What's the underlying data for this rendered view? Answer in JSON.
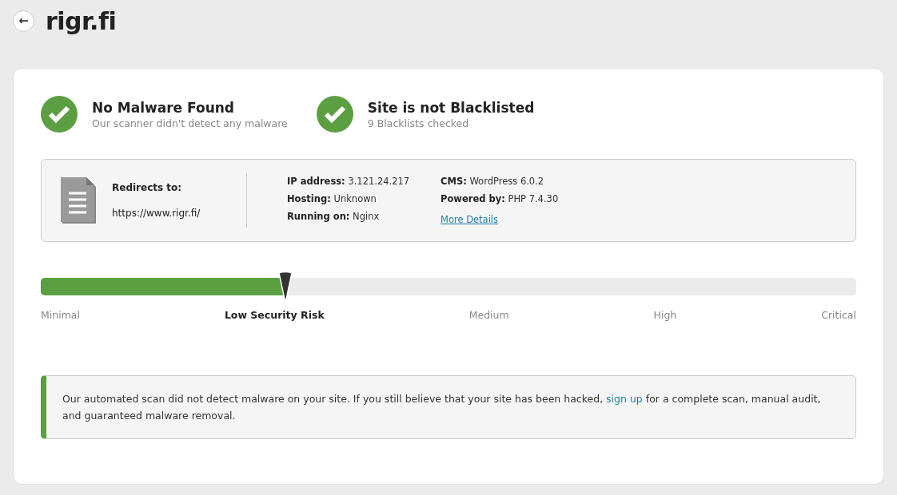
{
  "header": {
    "back_button": "←",
    "title": "rigr.fi"
  },
  "statuses": [
    {
      "title": "No Malware Found",
      "subtitle": "Our scanner didn't detect any malware",
      "ok": true
    },
    {
      "title": "Site is not Blacklisted",
      "subtitle": "9 Blacklists checked",
      "ok": true
    }
  ],
  "info": {
    "redirect_label": "Redirects to:",
    "redirect_url": "https://www.rigr.fi/",
    "columns": [
      [
        {
          "label": "IP address:",
          "value": "3.121.24.217"
        },
        {
          "label": "Hosting:",
          "value": "Unknown"
        },
        {
          "label": "Running on:",
          "value": "Nginx"
        }
      ],
      [
        {
          "label": "CMS:",
          "value": "WordPress 6.0.2"
        },
        {
          "label": "Powered by:",
          "value": "PHP 7.4.30"
        }
      ]
    ],
    "more_link": "More Details"
  },
  "risk": {
    "level": 0.3,
    "labels": [
      {
        "text": "Minimal",
        "selected": false
      },
      {
        "text": "Low Security Risk",
        "selected": true
      },
      {
        "text": "Medium",
        "selected": false
      },
      {
        "text": "High",
        "selected": false
      },
      {
        "text": "Critical",
        "selected": false
      }
    ]
  },
  "alert": {
    "before": "Our automated scan did not detect malware on your site. If you still believe that your site has been hacked, ",
    "link": "sign up",
    "after": " for a complete scan, manual audit, and guaranteed malware removal."
  }
}
